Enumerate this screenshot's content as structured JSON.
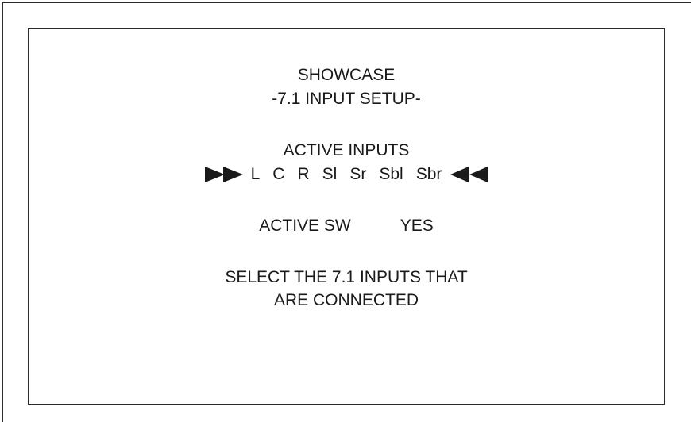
{
  "screen": {
    "title": "SHOWCASE",
    "subtitle": "-7.1 INPUT SETUP-",
    "active_inputs_label": "ACTIVE INPUTS",
    "channels": [
      "L",
      "C",
      "R",
      "Sl",
      "Sr",
      "Sbl",
      "Sbr"
    ],
    "selector_left_icon": "double-right-triangle-icon",
    "selector_right_icon": "double-left-triangle-icon",
    "active_sw": {
      "label": "ACTIVE SW",
      "value": "YES"
    },
    "message": [
      "SELECT THE 7.1 INPUTS THAT",
      "ARE CONNECTED"
    ]
  }
}
